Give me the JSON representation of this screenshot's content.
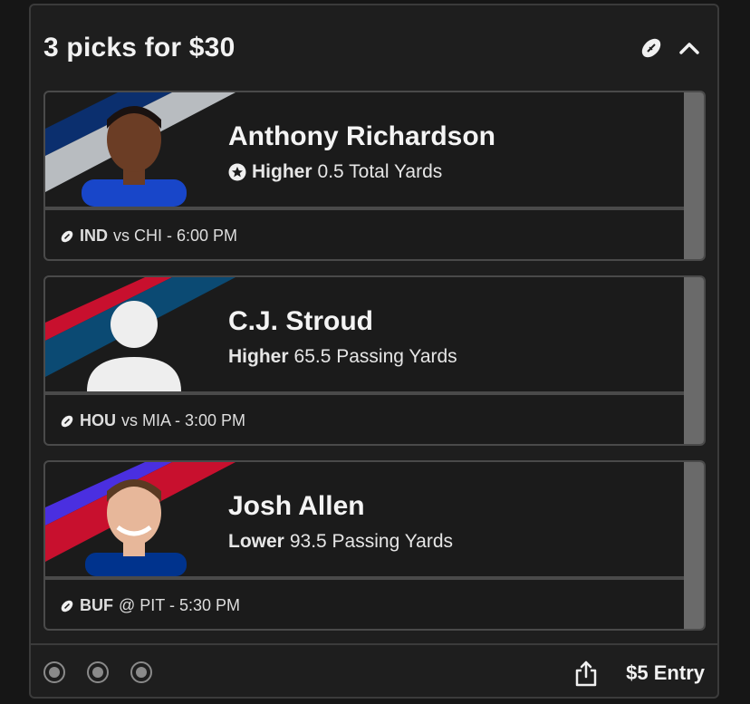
{
  "header": {
    "title": "3 picks for $30"
  },
  "picks": [
    {
      "player": "Anthony Richardson",
      "direction": "Higher",
      "line": "0.5 Total Yards",
      "team": "IND",
      "matchup": "vs CHI - 6:00 PM",
      "colors": [
        "#0b2f6e",
        "#b8bcc0"
      ]
    },
    {
      "player": "C.J. Stroud",
      "direction": "Higher",
      "line": "65.5 Passing Yards",
      "team": "HOU",
      "matchup": "vs MIA - 3:00 PM",
      "colors": [
        "#c8102e",
        "#0b4a73"
      ]
    },
    {
      "player": "Josh Allen",
      "direction": "Lower",
      "line": "93.5 Passing Yards",
      "team": "BUF",
      "matchup": "@ PIT - 5:30 PM",
      "colors": [
        "#4a2fe0",
        "#c8102e"
      ]
    }
  ],
  "footer": {
    "entry": "$5 Entry"
  }
}
